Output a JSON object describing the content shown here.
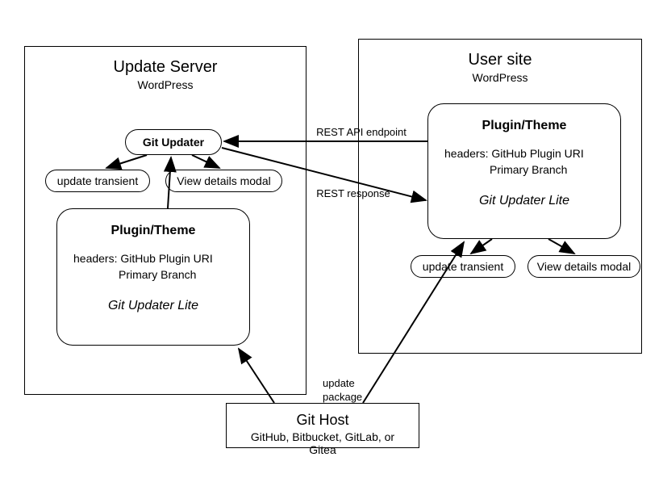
{
  "updateServer": {
    "title": "Update Server",
    "subtitle": "WordPress",
    "gitUpdater": "Git Updater",
    "updateTransient": "update transient",
    "viewDetails": "View details modal",
    "plugin": {
      "title": "Plugin/Theme",
      "headersLine1": "headers: GitHub Plugin URI",
      "headersLine2": "Primary Branch",
      "lite": "Git Updater Lite"
    }
  },
  "userSite": {
    "title": "User site",
    "subtitle": "WordPress",
    "plugin": {
      "title": "Plugin/Theme",
      "headersLine1": "headers: GitHub Plugin URI",
      "headersLine2": "Primary Branch",
      "lite": "Git Updater Lite"
    },
    "updateTransient": "update transient",
    "viewDetails": "View details modal"
  },
  "gitHost": {
    "title": "Git Host",
    "subtitle": "GitHub, Bitbucket, GitLab, or Gitea"
  },
  "labels": {
    "restEndpoint": "REST API endpoint",
    "restResponse": "REST response",
    "updatePackage": "update\npackage"
  }
}
